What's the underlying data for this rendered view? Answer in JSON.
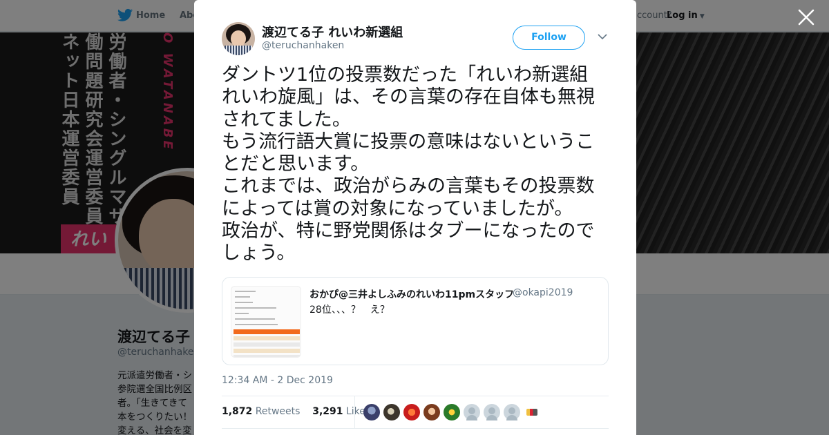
{
  "nav": {
    "home": "Home",
    "about": "Abo",
    "account_prompt": "account?",
    "login": "Log in"
  },
  "banner": {
    "col1": "ネット日本運営委員",
    "col2": "働問題研究会運営委員",
    "col3": "労働者・シングルマザー",
    "pink_text": "O WATANABE",
    "logo_text": "れい"
  },
  "background_profile": {
    "name": "渡辺てる子",
    "handle": "@teruchanhaken",
    "bio": "元派遣労働者・シ\n参院選全国比例区\n者。「生きてきて\n本をつくりたい！\n変える、社会を変"
  },
  "tweet": {
    "author_name": "渡辺てる子 れいわ新選組",
    "author_handle": "@teruchanhaken",
    "follow_label": "Follow",
    "text": "ダントツ1位の投票数だった「れいわ新選組　れいわ旋風」は、その言葉の存在自体も無視されてました。\nもう流行語大賞に投票の意味はないということだと思います。\nこれまでは、政治がらみの言葉もその投票数によっては賞の対象になっていましたが。\n政治が、特に野党関係はタブーになったのでしょう。",
    "timestamp": "12:34 AM - 2 Dec 2019",
    "retweets_count": "1,872",
    "retweets_label": "Retweets",
    "likes_count": "3,291",
    "likes_label": "Likes"
  },
  "quoted": {
    "name": "おかぴ@三井よしふみのれいわ11pmスタッフ",
    "handle": "@okapi2019",
    "text": "28位、、、？　え？"
  },
  "colors": {
    "accent": "#1da1f2",
    "brand_pink": "#e8336d",
    "text": "#14171a",
    "muted": "#657786"
  },
  "icons": [
    "twitter-bird-icon",
    "close-icon",
    "chevron-down-icon",
    "caret-down-icon"
  ]
}
